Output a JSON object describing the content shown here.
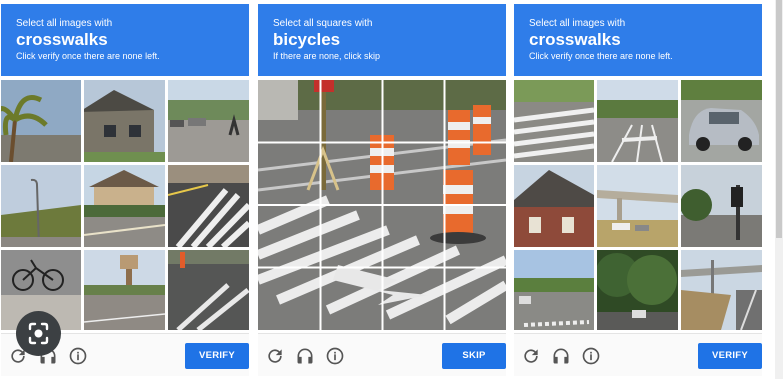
{
  "panels": [
    {
      "header": {
        "line1": "Select all images with",
        "target": "crosswalks",
        "line3": "Click verify once there are none left."
      },
      "footer": {
        "button": "VERIFY"
      }
    },
    {
      "header": {
        "line1": "Select all squares with",
        "target": "bicycles",
        "line3": "If there are none, click skip"
      },
      "footer": {
        "button": "SKIP"
      }
    },
    {
      "header": {
        "line1": "Select all images with",
        "target": "crosswalks",
        "line3": "Click verify once there are none left."
      },
      "footer": {
        "button": "VERIFY"
      }
    }
  ],
  "icons": {
    "reload": "reload-icon",
    "audio": "headphones-icon",
    "info": "info-icon",
    "lens": "google-lens-icon"
  },
  "colors": {
    "header_blue": "#2f7de9",
    "button_blue": "#1f73e6",
    "icon_gray": "#555555"
  }
}
